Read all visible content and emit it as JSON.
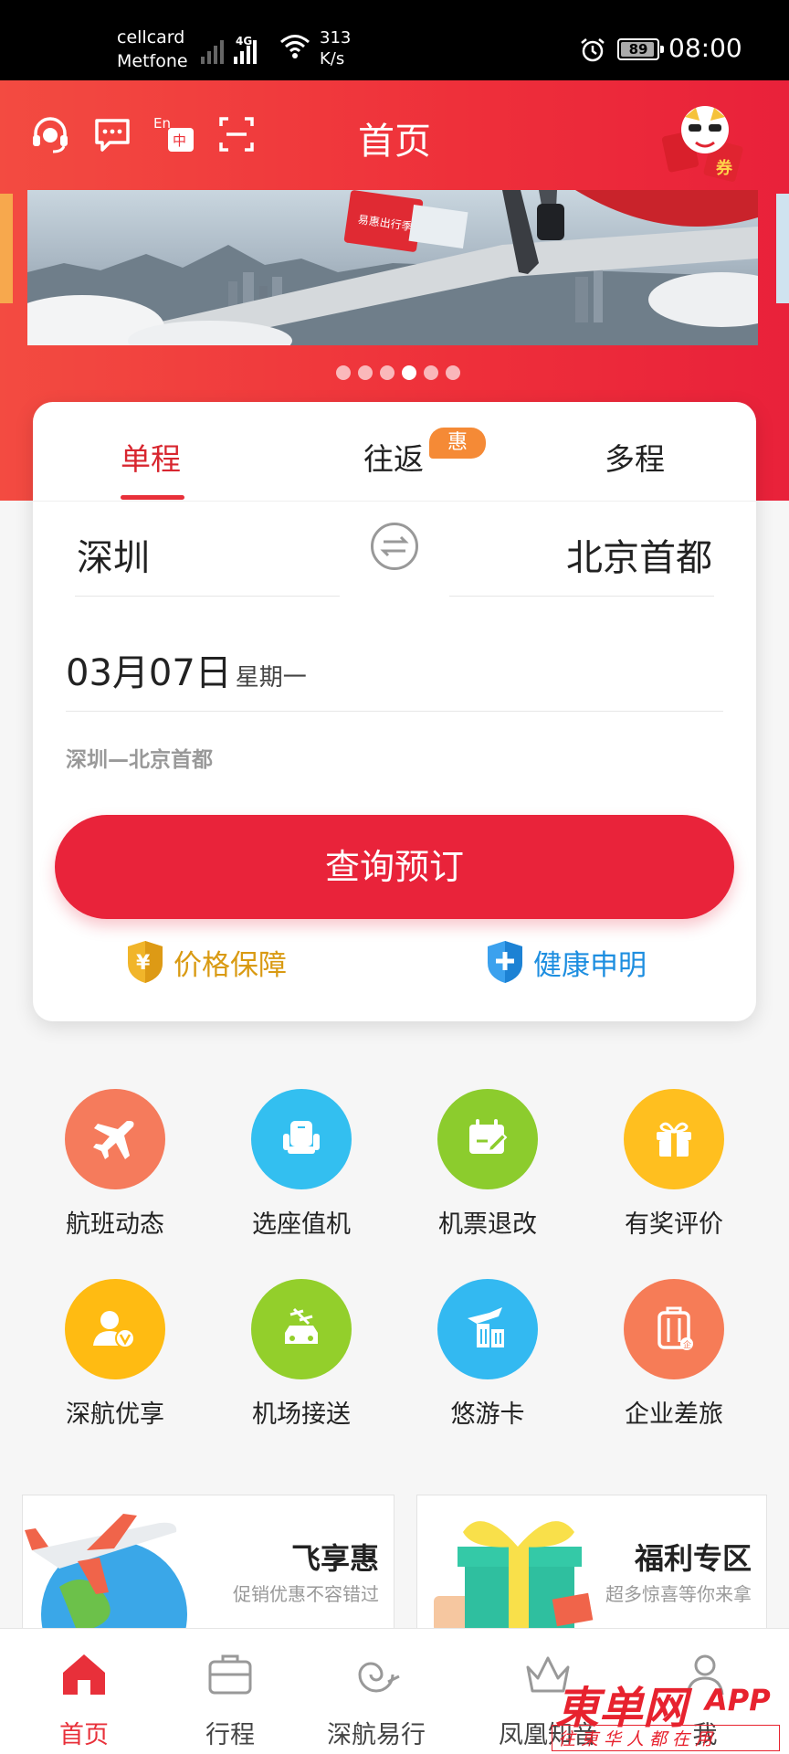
{
  "status_bar": {
    "carrier_line1": "cellcard",
    "carrier_line2": "Metfone",
    "network": "4G",
    "speed_value": "313",
    "speed_unit": "K/s",
    "battery": "89",
    "time": "08:00"
  },
  "header": {
    "title": "首页",
    "icons": [
      "headset-icon",
      "message-icon",
      "language-icon",
      "scan-icon"
    ]
  },
  "banner": {
    "slide_count": 6,
    "active_slide": 4,
    "ad_text": "易惠出行季"
  },
  "booking": {
    "tabs": [
      {
        "label": "单程",
        "active": true
      },
      {
        "label": "往返",
        "badge": "惠"
      },
      {
        "label": "多程"
      }
    ],
    "from_city": "深圳",
    "to_city": "北京首都",
    "date": "03月07日",
    "weekday": "星期一",
    "route": "深圳—北京首都",
    "search_label": "查询预订",
    "guarantee_price": "价格保障",
    "guarantee_health": "健康申明"
  },
  "services": [
    {
      "label": "航班动态",
      "color": "#f57b5c",
      "icon": "plane-icon"
    },
    {
      "label": "选座值机",
      "color": "#33bff0",
      "icon": "seat-icon"
    },
    {
      "label": "机票退改",
      "color": "#8ccc2d",
      "icon": "calendar-edit-icon"
    },
    {
      "label": "有奖评价",
      "color": "#ffbf1f",
      "icon": "gift-icon"
    },
    {
      "label": "深航优享",
      "color": "#ffbb12",
      "icon": "vip-user-icon"
    },
    {
      "label": "机场接送",
      "color": "#93cf2b",
      "icon": "car-icon"
    },
    {
      "label": "悠游卡",
      "color": "#33b9f1",
      "icon": "building-icon"
    },
    {
      "label": "企业差旅",
      "color": "#f67c57",
      "icon": "luggage-icon"
    }
  ],
  "promos": [
    {
      "title": "飞享惠",
      "subtitle": "促销优惠不容错过"
    },
    {
      "title": "福利专区",
      "subtitle": "超多惊喜等你来拿"
    }
  ],
  "bottom_nav": [
    {
      "label": "首页",
      "active": true
    },
    {
      "label": "行程"
    },
    {
      "label": "深航易行"
    },
    {
      "label": "凤凰知音"
    },
    {
      "label": "我"
    }
  ],
  "watermark": {
    "brand": "東单网",
    "app": "APP",
    "slogan": "往東华人都在用"
  },
  "colors": {
    "brand_red": "#e9233a",
    "price_gold": "#d99a12",
    "health_blue": "#1d8ee0"
  }
}
